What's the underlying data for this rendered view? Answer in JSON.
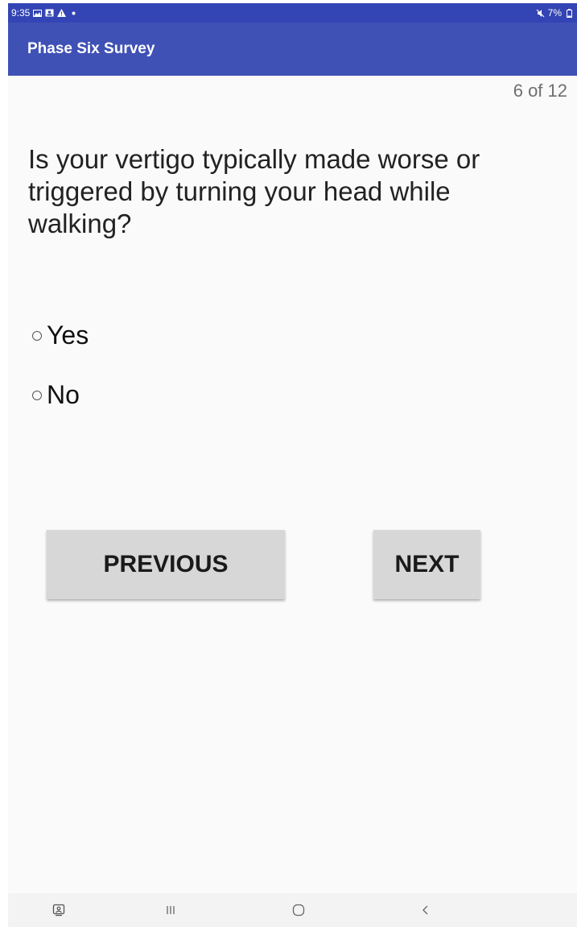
{
  "status_bar": {
    "time": "9:35",
    "battery": "7%",
    "icons": [
      "image-icon",
      "contact-card-icon",
      "warning-icon",
      "dot-icon",
      "mute-icon",
      "battery-icon"
    ]
  },
  "app_bar": {
    "title": "Phase Six Survey",
    "color": "#3f51b5"
  },
  "survey": {
    "progress": "6 of 12",
    "question": "Is your vertigo typically made worse or triggered by turning your head while walking?",
    "options": [
      {
        "label": "Yes",
        "selected": false
      },
      {
        "label": "No",
        "selected": false
      }
    ]
  },
  "buttons": {
    "previous_label": "PREVIOUS",
    "next_label": "NEXT"
  },
  "nav_bar": {
    "icons": [
      "assistant-icon",
      "recent-apps-icon",
      "home-icon",
      "back-icon"
    ]
  }
}
